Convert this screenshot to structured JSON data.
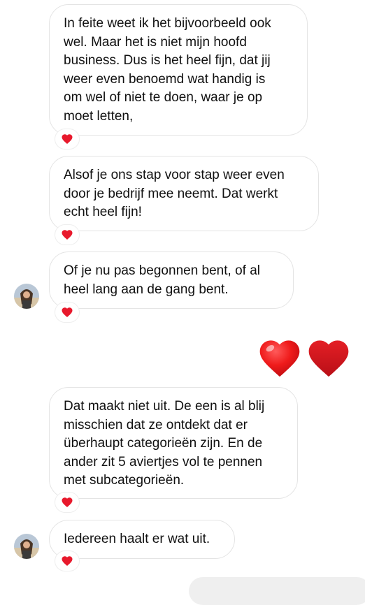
{
  "messages": [
    {
      "text": "In feite weet ik het bijvoorbeeld ook\nwel. Maar het is niet mijn hoofd\nbusiness. Dus is het heel fijn, dat jij\nweer even benoemd wat handig is\nom wel of niet te doen, waar je op\nmoet letten,",
      "reaction": "red-heart"
    },
    {
      "text": "Alsof je ons stap voor stap weer even\ndoor je bedrijf mee neemt. Dat werkt\necht heel fijn!",
      "reaction": "red-heart"
    },
    {
      "text": "Of je nu pas begonnen bent, of al\nheel lang aan de gang bent.",
      "reaction": "red-heart"
    },
    {
      "text": "Dat maakt niet uit. De een is al blij\nmisschien dat ze ontdekt dat er\nüberhaupt categorieën zijn. En de\nander zit 5 aviertjes vol te pennen\nmet subcategorieën.",
      "reaction": "red-heart"
    },
    {
      "text": "Iedereen haalt er wat uit.",
      "reaction": "red-heart"
    }
  ],
  "sent_emoji": [
    "heart-icon",
    "heart-icon"
  ],
  "colors": {
    "bubble_border": "#e4e4e4",
    "heart_red": "#e8192c",
    "sent_bubble": "#efefef"
  }
}
